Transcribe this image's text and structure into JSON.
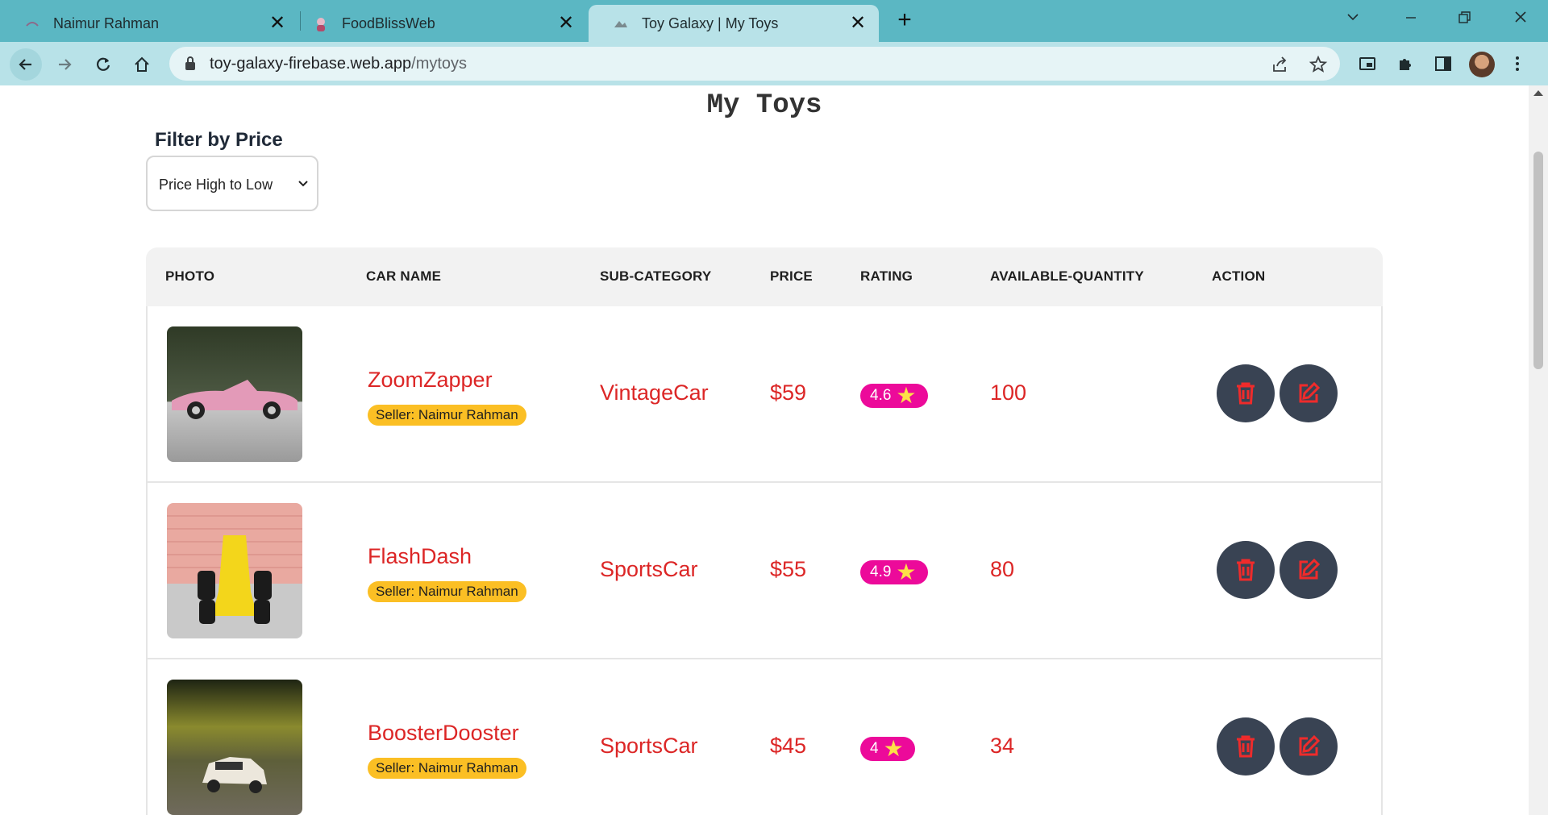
{
  "browser": {
    "tabs": [
      {
        "title": "Naimur Rahman",
        "active": false
      },
      {
        "title": "FoodBlissWeb",
        "active": false
      },
      {
        "title": "Toy Galaxy | My Toys",
        "active": true
      }
    ],
    "url_host": "toy-galaxy-firebase.web.app",
    "url_path": "/mytoys"
  },
  "page": {
    "title": "My Toys",
    "filter_label": "Filter by Price",
    "filter_value": "Price High to Low"
  },
  "table": {
    "headers": {
      "photo": "PHOTO",
      "car_name": "CAR NAME",
      "sub_category": "SUB-CATEGORY",
      "price": "PRICE",
      "rating": "RATING",
      "quantity": "AVAILABLE-QUANTITY",
      "action": "ACTION"
    },
    "rows": [
      {
        "name": "ZoomZapper",
        "seller": "Seller: Naimur Rahman",
        "sub_category": "VintageCar",
        "price": "$59",
        "rating": "4.6",
        "quantity": "100"
      },
      {
        "name": "FlashDash",
        "seller": "Seller: Naimur Rahman",
        "sub_category": "SportsCar",
        "price": "$55",
        "rating": "4.9",
        "quantity": "80"
      },
      {
        "name": "BoosterDooster",
        "seller": "Seller: Naimur Rahman",
        "sub_category": "SportsCar",
        "price": "$45",
        "rating": "4",
        "quantity": "34"
      }
    ]
  },
  "colors": {
    "accent_red": "#dc2626",
    "seller_badge": "#fbbf24",
    "rating_badge": "#ec0a9a",
    "action_button": "#394353",
    "tab_bar": "#5bb7c3"
  },
  "icons": [
    "back-arrow-icon",
    "forward-arrow-icon",
    "reload-icon",
    "home-icon",
    "lock-icon",
    "share-icon",
    "star-bookmark-icon",
    "picture-in-picture-icon",
    "extensions-icon",
    "side-panel-icon",
    "menu-dots-icon",
    "trash-icon",
    "edit-icon",
    "chevron-down-icon"
  ]
}
